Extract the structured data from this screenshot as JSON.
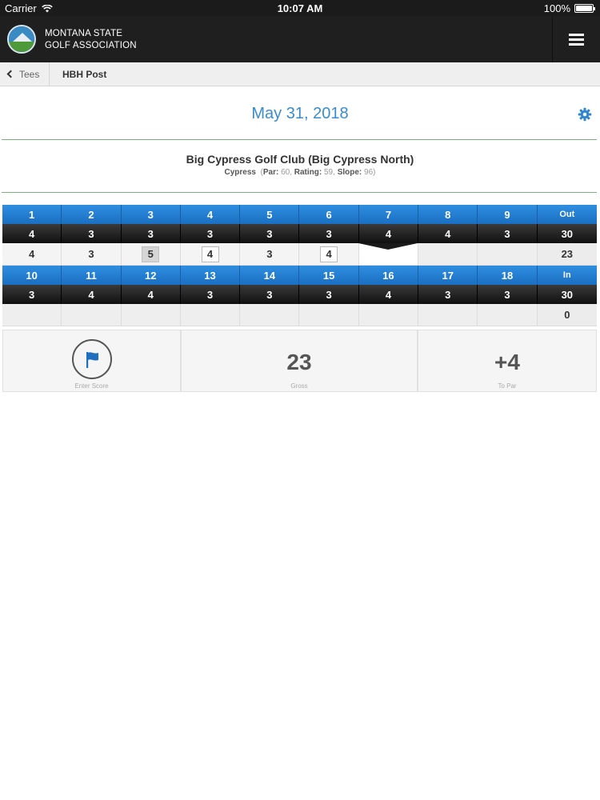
{
  "status_bar": {
    "carrier": "Carrier",
    "time": "10:07 AM",
    "battery": "100%"
  },
  "header": {
    "brand_line1": "MONTANA STATE",
    "brand_line2": "GOLF ASSOCIATION"
  },
  "breadcrumb": {
    "back_label": "Tees",
    "current": "HBH Post"
  },
  "date": "May 31, 2018",
  "course": {
    "name": "Big Cypress Golf Club (Big Cypress North)",
    "tee": "Cypress",
    "par_label": "Par:",
    "par": "60",
    "rating_label": "Rating:",
    "rating": "59",
    "slope_label": "Slope:",
    "slope": "96"
  },
  "front_nine": {
    "holes": [
      "1",
      "2",
      "3",
      "4",
      "5",
      "6",
      "7",
      "8",
      "9"
    ],
    "total_label": "Out",
    "pars": [
      "4",
      "3",
      "3",
      "3",
      "3",
      "3",
      "4",
      "4",
      "3"
    ],
    "par_total": "30",
    "scores": [
      "4",
      "3",
      "5",
      "4",
      "3",
      "4",
      "",
      "",
      ""
    ],
    "score_total": "23"
  },
  "back_nine": {
    "holes": [
      "10",
      "11",
      "12",
      "13",
      "14",
      "15",
      "16",
      "17",
      "18"
    ],
    "total_label": "In",
    "pars": [
      "3",
      "4",
      "4",
      "3",
      "3",
      "3",
      "4",
      "3",
      "3"
    ],
    "par_total": "30",
    "scores": [
      "",
      "",
      "",
      "",
      "",
      "",
      "",
      "",
      ""
    ],
    "score_total": "0"
  },
  "summary": {
    "enter_score_label": "Enter Score",
    "gross": "23",
    "gross_label": "Gross",
    "to_par": "+4",
    "to_par_label": "To Par"
  },
  "colors": {
    "accent_blue": "#3a8ccc",
    "row_blue": "#1a6fc2",
    "divider_green": "#7ab27a"
  }
}
